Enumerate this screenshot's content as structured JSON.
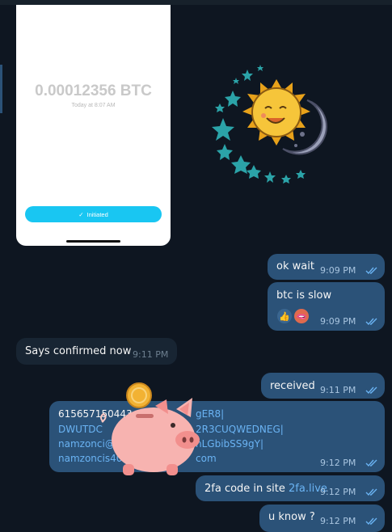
{
  "screenshot": {
    "amount": "0.00012356 BTC",
    "time": "Today at 8:07 AM",
    "status_label": "Initiated"
  },
  "messages": [
    {
      "text": "ok wait",
      "time": "9:09 PM"
    },
    {
      "text": "btc is slow",
      "time": "9:09 PM",
      "reactions": [
        "👍",
        "🫦"
      ]
    },
    {
      "text": "Says confirmed now",
      "time": "9:11 PM"
    },
    {
      "text": "received",
      "time": "9:11 PM"
    },
    {
      "lines": [
        "615657150443",
        "gER8|",
        "DWUTDC",
        "2R3CUQWEDNEG|",
        "namzonci@",
        "hLGbibSS9gY|",
        "namzoncis40",
        "com"
      ],
      "time": "9:12 PM"
    },
    {
      "text": "2fa code in site ",
      "link": "2fa.live",
      "time": "9:12 PM"
    },
    {
      "text": "u know ?",
      "time": "9:12 PM"
    }
  ],
  "colors": {
    "outgoing": "#2b5278",
    "incoming": "#182533",
    "link": "#6ab3f3",
    "background": "#0e1621"
  },
  "icons": [
    "double-check-icon",
    "sun-moon-sticker",
    "piggy-bank-sticker"
  ]
}
